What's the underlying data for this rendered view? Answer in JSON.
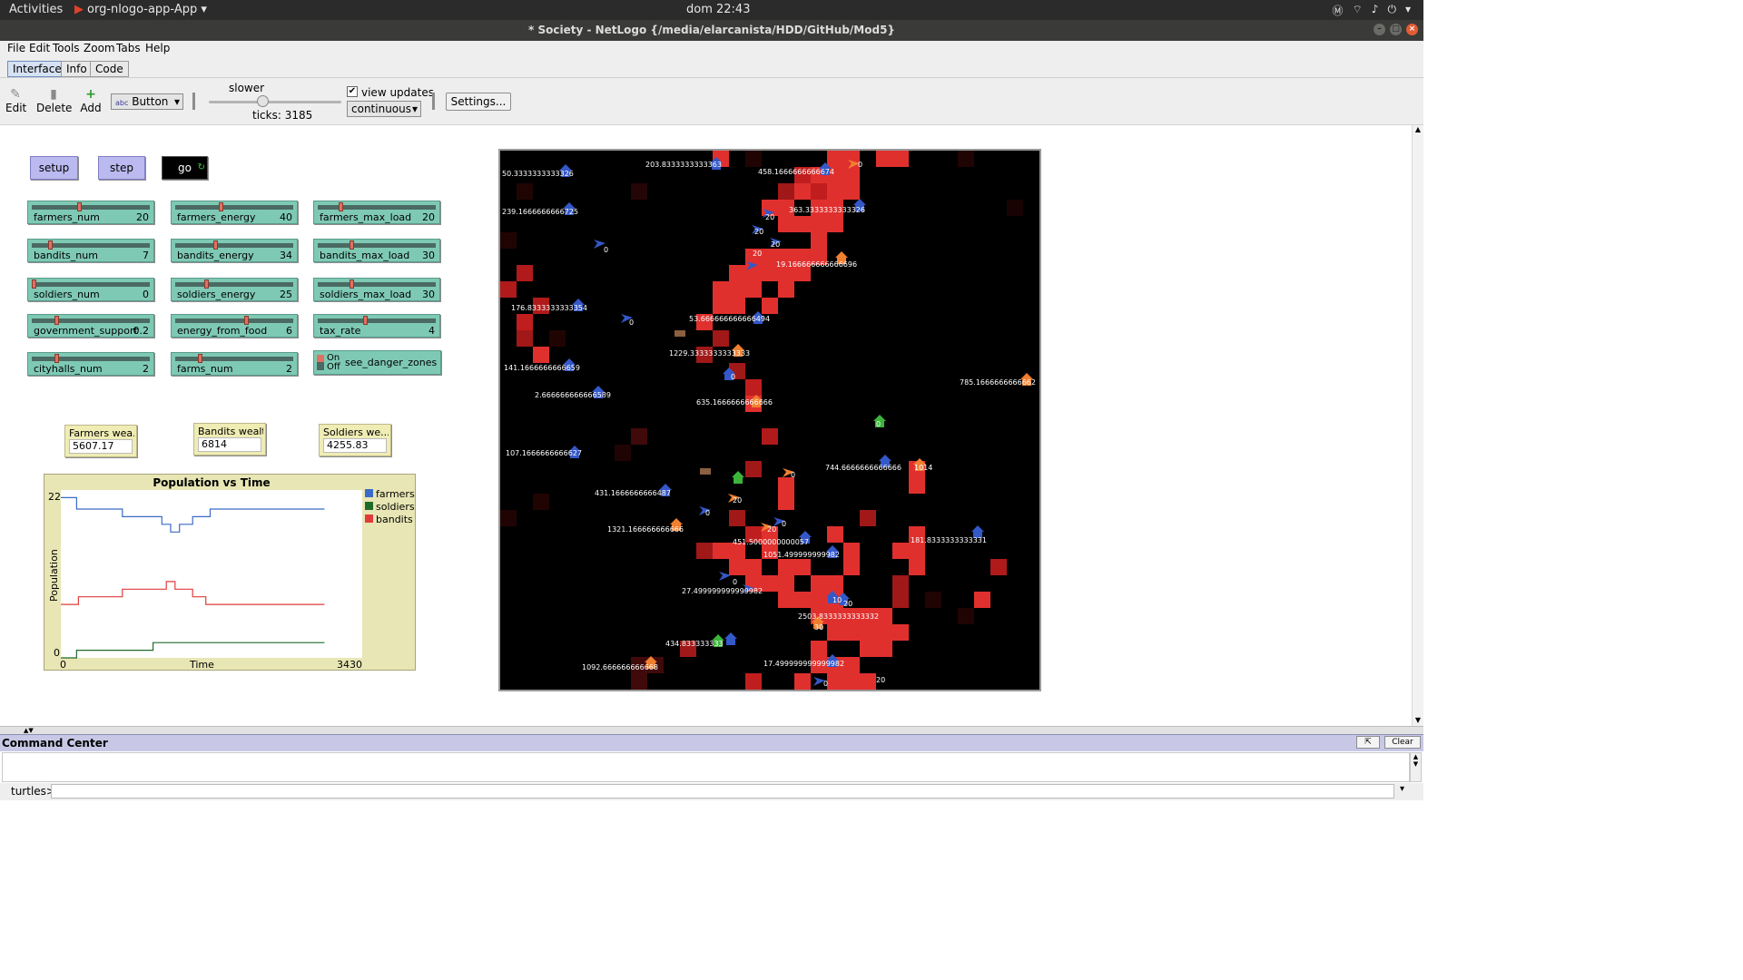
{
  "system_bar": {
    "activities": "Activities",
    "app_name": "org-nlogo-app-App",
    "clock": "dom 22:43"
  },
  "window": {
    "title": "* Society - NetLogo {/media/elarcanista/HDD/GitHub/Mod5}"
  },
  "menu": [
    "File",
    "Edit",
    "Tools",
    "Zoom",
    "Tabs",
    "Help"
  ],
  "tabs": [
    "Interface",
    "Info",
    "Code"
  ],
  "toolbar": {
    "edit": "Edit",
    "delete": "Delete",
    "add": "Add",
    "widget_type": "Button",
    "speed_label": "slower",
    "ticks": "ticks: 3185",
    "view_updates": "view updates",
    "update_mode": "continuous",
    "settings": "Settings..."
  },
  "buttons": {
    "setup": "setup",
    "step": "step",
    "go": "go"
  },
  "sliders": [
    {
      "name": "farmers_num",
      "value": "20",
      "fraction": 0.4
    },
    {
      "name": "farmers_energy",
      "value": "40",
      "fraction": 0.38
    },
    {
      "name": "farmers_max_load",
      "value": "20",
      "fraction": 0.18
    },
    {
      "name": "bandits_num",
      "value": "7",
      "fraction": 0.14
    },
    {
      "name": "bandits_energy",
      "value": "34",
      "fraction": 0.33
    },
    {
      "name": "bandits_max_load",
      "value": "30",
      "fraction": 0.28
    },
    {
      "name": "soldiers_num",
      "value": "0",
      "fraction": 0.0
    },
    {
      "name": "soldiers_energy",
      "value": "25",
      "fraction": 0.25
    },
    {
      "name": "soldiers_max_load",
      "value": "30",
      "fraction": 0.28
    },
    {
      "name": "government_support",
      "value": "0.2",
      "fraction": 0.2
    },
    {
      "name": "energy_from_food",
      "value": "6",
      "fraction": 0.6
    },
    {
      "name": "tax_rate",
      "value": "4",
      "fraction": 0.4
    },
    {
      "name": "cityhalls_num",
      "value": "2",
      "fraction": 0.2
    },
    {
      "name": "farms_num",
      "value": "2",
      "fraction": 0.2
    }
  ],
  "switch": {
    "on": "On",
    "off": "Off",
    "name": "see_danger_zones"
  },
  "monitors": [
    {
      "name": "Farmers wea...",
      "value": "5607.17"
    },
    {
      "name": "Bandits wealth",
      "value": "6814"
    },
    {
      "name": "Soldiers we...",
      "value": "4255.83"
    }
  ],
  "plot": {
    "title": "Population vs Time",
    "ylabel": "Population",
    "xlabel": "Time",
    "ymax_label": "22",
    "ymin_label": "0",
    "xmin_label": "0",
    "xmax_label": "3430",
    "legend": [
      {
        "name": "farmers",
        "color": "#3a6bc8"
      },
      {
        "name": "soldiers",
        "color": "#1f6b2a"
      },
      {
        "name": "bandits",
        "color": "#e03c3c"
      }
    ]
  },
  "chart_data": {
    "type": "line",
    "title": "Population vs Time",
    "xlabel": "Time",
    "ylabel": "Population",
    "xlim": [
      0,
      3430
    ],
    "ylim": [
      0,
      22
    ],
    "series": [
      {
        "name": "farmers",
        "color": "#3a6bc8",
        "points": [
          [
            0,
            21
          ],
          [
            180,
            21
          ],
          [
            180,
            19.5
          ],
          [
            700,
            19.5
          ],
          [
            700,
            18.5
          ],
          [
            1150,
            18.5
          ],
          [
            1150,
            17.5
          ],
          [
            1250,
            17.5
          ],
          [
            1250,
            16.5
          ],
          [
            1350,
            16.5
          ],
          [
            1350,
            17.5
          ],
          [
            1500,
            17.5
          ],
          [
            1500,
            18.5
          ],
          [
            1700,
            18.5
          ],
          [
            1700,
            19.5
          ],
          [
            3000,
            19.5
          ]
        ]
      },
      {
        "name": "soldiers",
        "color": "#1f6b2a",
        "points": [
          [
            0,
            0
          ],
          [
            180,
            0
          ],
          [
            180,
            1
          ],
          [
            1050,
            1
          ],
          [
            1050,
            2
          ],
          [
            3000,
            2
          ]
        ]
      },
      {
        "name": "bandits",
        "color": "#e03c3c",
        "points": [
          [
            0,
            7
          ],
          [
            200,
            7
          ],
          [
            200,
            8
          ],
          [
            700,
            8
          ],
          [
            700,
            9
          ],
          [
            1200,
            9
          ],
          [
            1200,
            10
          ],
          [
            1300,
            10
          ],
          [
            1300,
            9
          ],
          [
            1500,
            9
          ],
          [
            1500,
            8
          ],
          [
            1650,
            8
          ],
          [
            1650,
            7
          ],
          [
            3000,
            7
          ]
        ]
      }
    ]
  },
  "world_labels": [
    "50.3333333333326",
    "203.8333333333363",
    "458.1666666666674",
    "0",
    "239.1666666666725",
    "363.3333333333326",
    "20",
    "20",
    "20",
    "0",
    "19.166666666666696",
    "20",
    "176.8333333333354",
    "0",
    "53.666666666666494",
    "1229.3333333333333",
    "141.1666666666659",
    "0",
    "785.1666666666662",
    "2.666666666666589",
    "635.1666666666666",
    "0",
    "107.1666666666627",
    "744.6666666666666",
    "1014",
    "0",
    "431.1666666666487",
    "20",
    "0",
    "20",
    "0",
    "1321.166666666666",
    "451.5000000000057",
    "181.8333333333331",
    "1051.499999999982",
    "0",
    "27.499999999999982",
    "10",
    "20",
    "2503.8333333333332",
    "30",
    "434.833333333",
    "1092.666666666668",
    "17.499999999999982",
    "0",
    "20"
  ],
  "command_center": {
    "title": "Command Center",
    "clear": "Clear",
    "agent": "turtles>"
  }
}
